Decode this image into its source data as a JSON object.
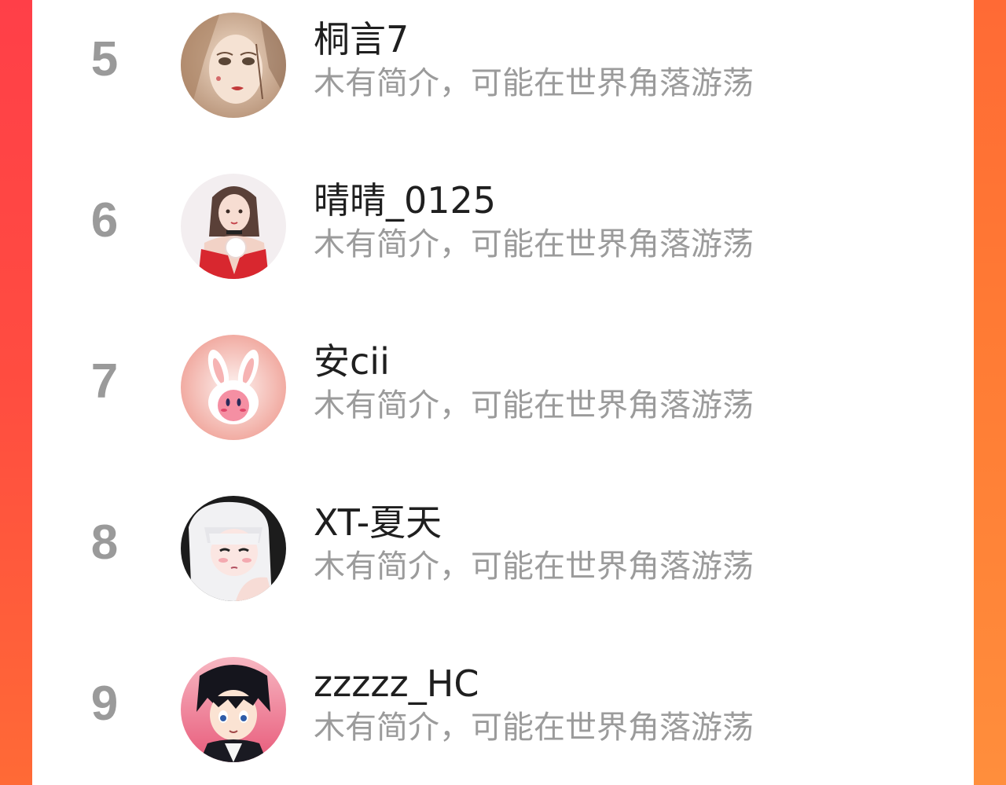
{
  "ranking": {
    "items": [
      {
        "rank": "5",
        "name": "桐言7",
        "bio": "木有简介，可能在世界角落游荡",
        "avatar_icon": "girl-portrait-avatar"
      },
      {
        "rank": "6",
        "name": "晴晴_0125",
        "bio": "木有简介，可能在世界角落游荡",
        "avatar_icon": "illustrated-girl-avatar"
      },
      {
        "rank": "7",
        "name": "安cii",
        "bio": "木有简介，可能在世界角落游荡",
        "avatar_icon": "bunny-kirby-avatar"
      },
      {
        "rank": "8",
        "name": "XT-夏天",
        "bio": "木有简介，可能在世界角落游荡",
        "avatar_icon": "anime-white-hair-avatar"
      },
      {
        "rank": "9",
        "name": "zzzzz_HC",
        "bio": "木有简介，可能在世界角落游荡",
        "avatar_icon": "anime-boy-avatar"
      }
    ]
  },
  "colors": {
    "rank_number": "#9a9a9a",
    "name_text": "#1f1f1f",
    "bio_text": "#9b9b9b",
    "card_background": "#ffffff",
    "frame_left": "#ff4444",
    "frame_right": "#ff7a34"
  }
}
